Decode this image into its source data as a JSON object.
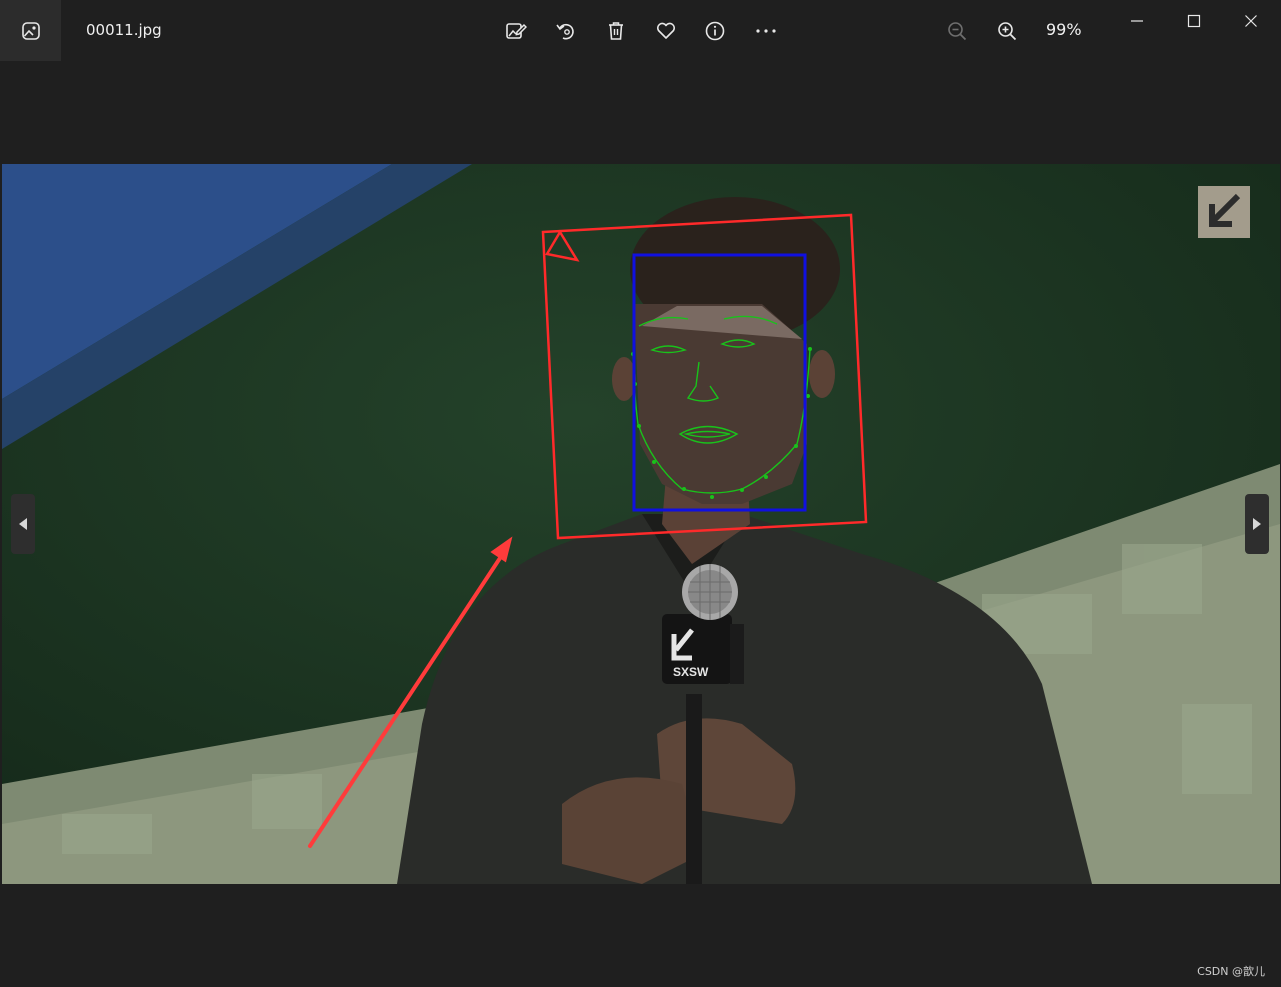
{
  "window": {
    "filename": "00011.jpg",
    "zoom_level": "99%"
  },
  "toolbar": {
    "icons": [
      "edit-image-icon",
      "rotate-icon",
      "delete-icon",
      "favorite-icon",
      "info-icon",
      "more-icon"
    ]
  },
  "zoom": {
    "icons": [
      "zoom-out-icon",
      "zoom-in-icon"
    ]
  },
  "window_controls": [
    "minimize-icon",
    "maximize-icon",
    "close-icon"
  ],
  "photo": {
    "mic_logo_text": "SXSW"
  },
  "colors": {
    "background": "#1f1f1f",
    "annotation_red": "#ff2a2a",
    "annotation_blue": "#1010e0",
    "landmark_green": "#19c21b"
  },
  "footer": {
    "watermark": "CSDN @歆儿"
  }
}
